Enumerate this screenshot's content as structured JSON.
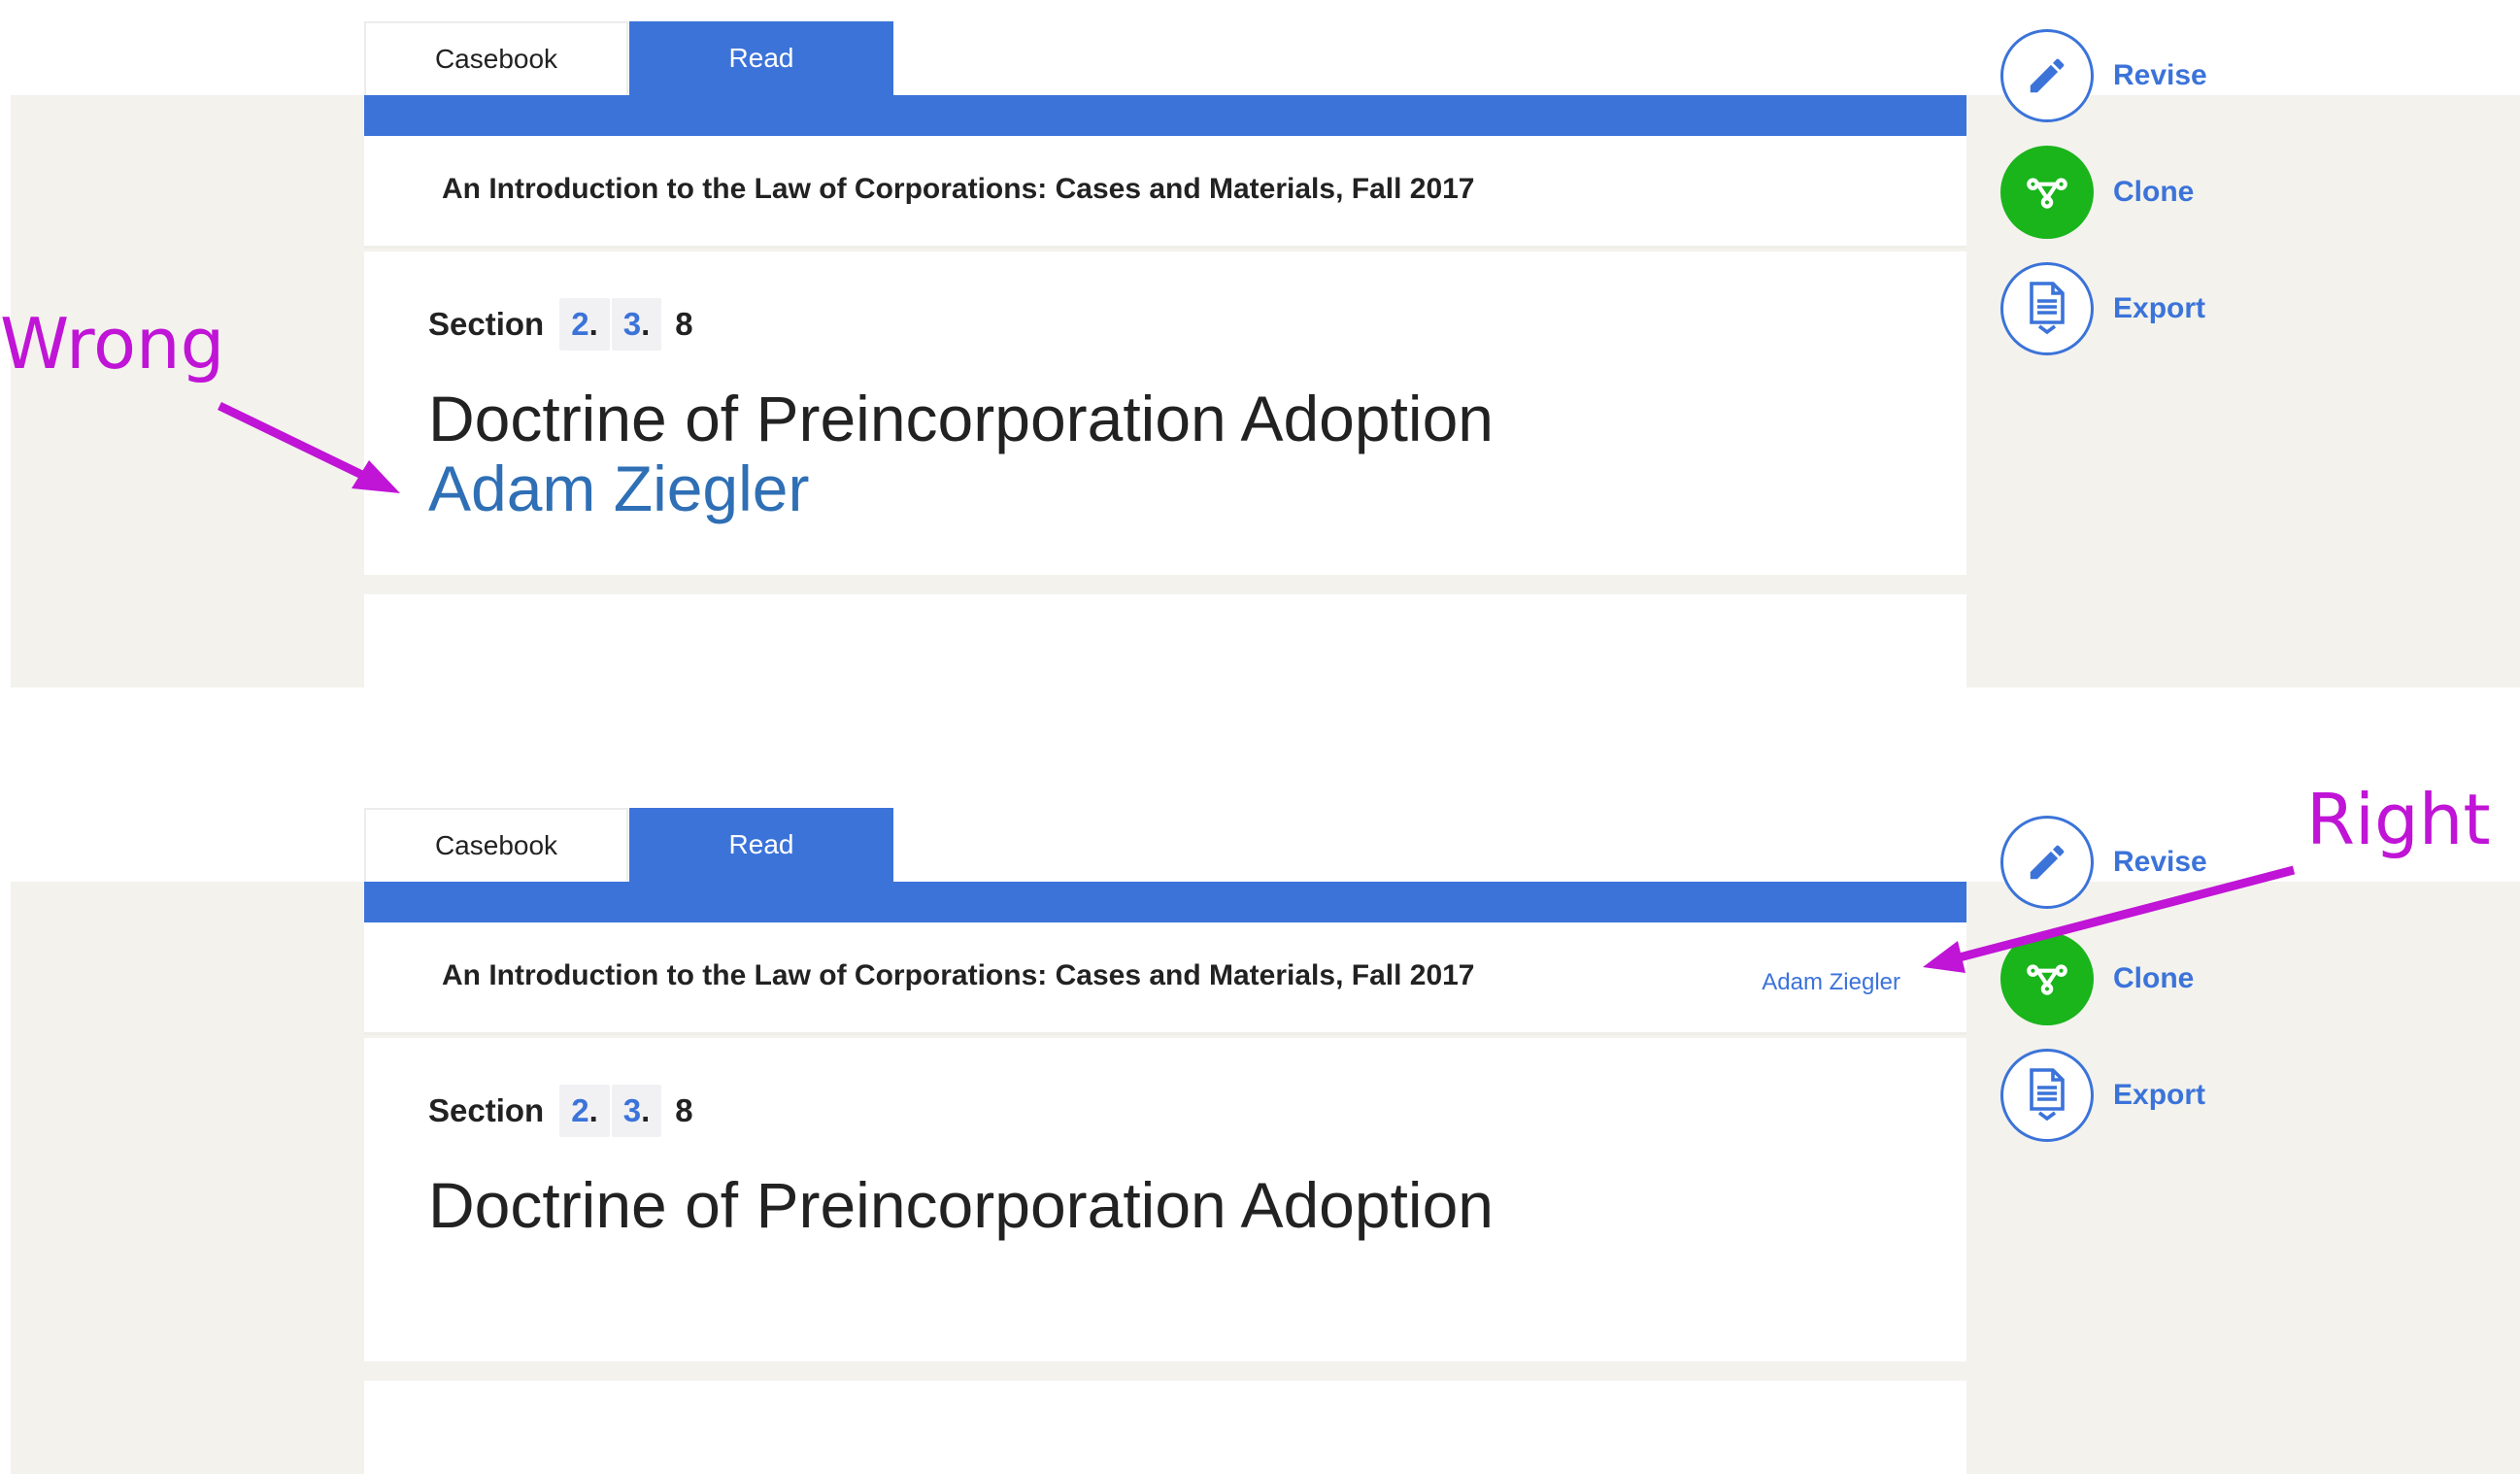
{
  "tabs": {
    "casebook": "Casebook",
    "read": "Read"
  },
  "casebook_title": "An Introduction to the Law of Corporations: Cases and Materials, Fall 2017",
  "section": {
    "label": "Section",
    "part1": "2",
    "part2": "3",
    "part3": "8",
    "sep": "."
  },
  "document_title": "Doctrine of Preincorporation Adoption",
  "author": "Adam Ziegler",
  "actions": {
    "revise": "Revise",
    "clone": "Clone",
    "export": "Export"
  },
  "annotations": {
    "wrong": "Wrong",
    "right": "Right"
  },
  "colors": {
    "brand_blue": "#3b73d9",
    "clone_green": "#19b51b",
    "annotation": "#c014d6",
    "page_bg": "#f3f2ed"
  },
  "icons": {
    "revise": "pencil-icon",
    "clone": "branch-icon",
    "export": "document-download-icon"
  }
}
